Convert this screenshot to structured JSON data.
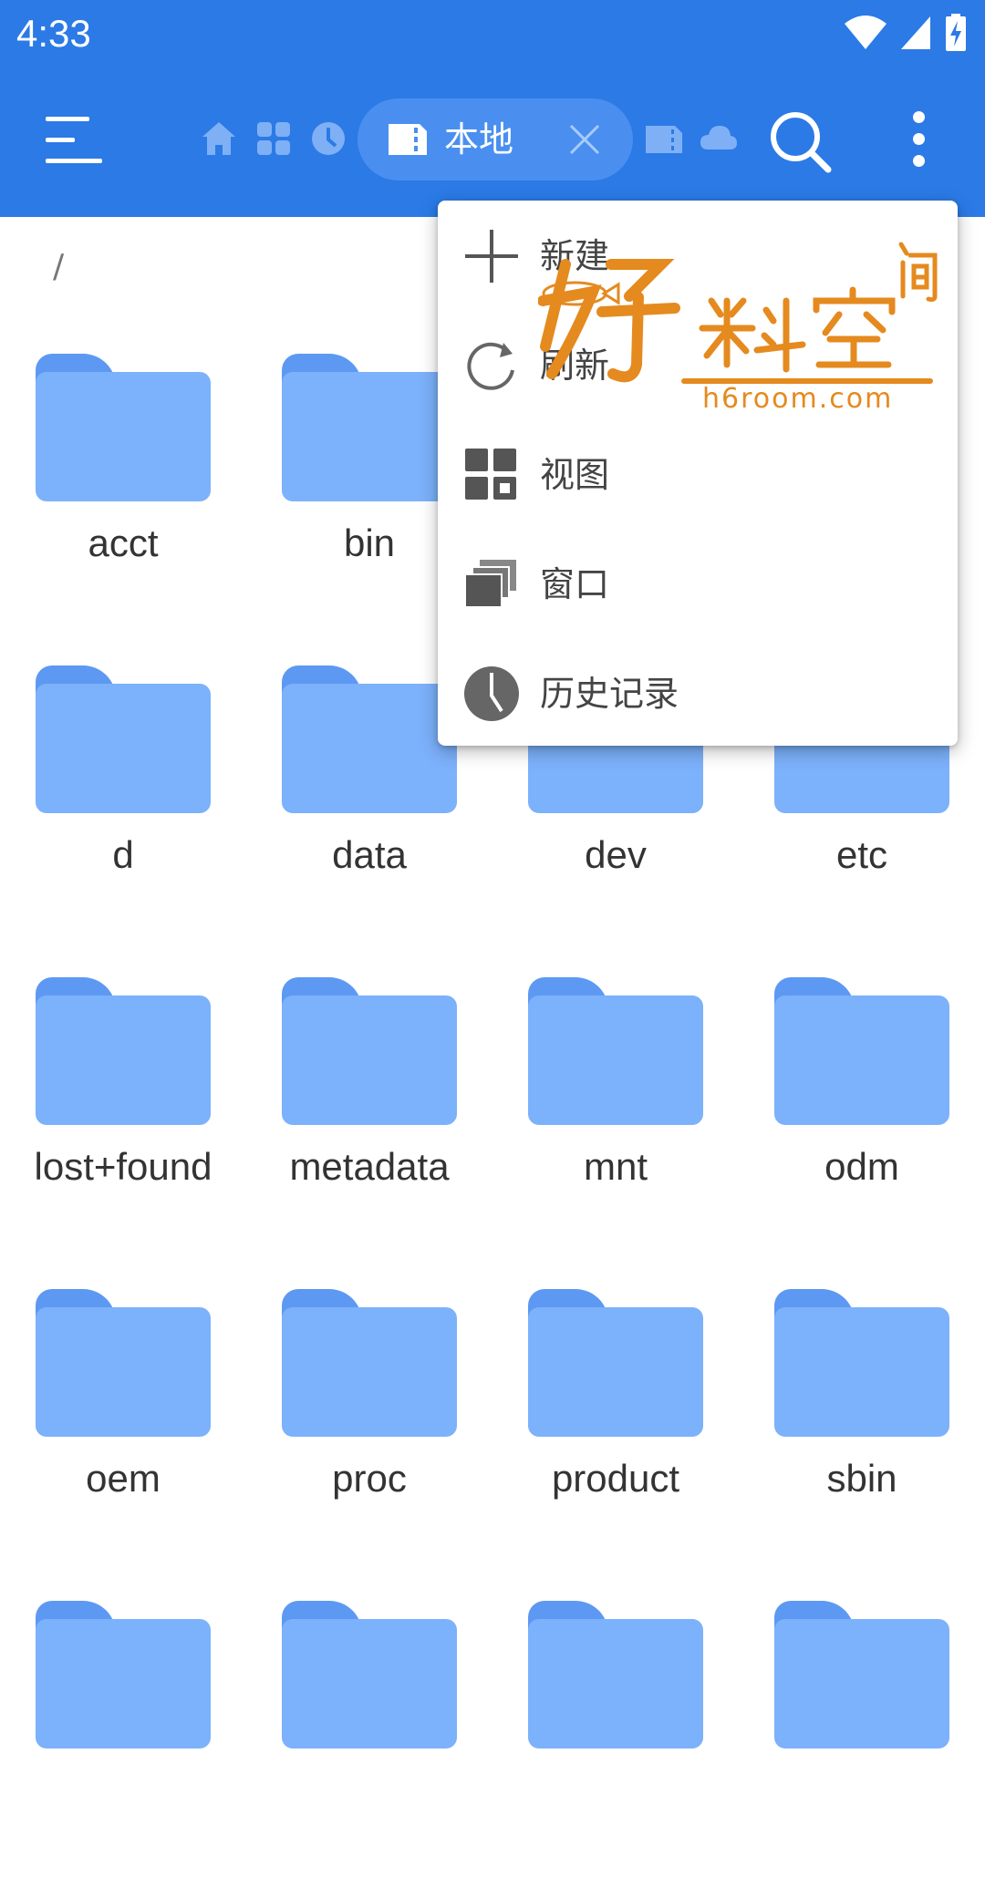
{
  "status_bar": {
    "time": "4:33"
  },
  "app_bar": {
    "active_tab_label": "本地",
    "tab_icons": [
      "home-icon",
      "apps-icon",
      "clock-icon",
      "sd-card-icon",
      "device-icon",
      "cloud-icon"
    ]
  },
  "path": "/",
  "folders": [
    {
      "name": "acct"
    },
    {
      "name": "bin"
    },
    {
      "name": ""
    },
    {
      "name": ""
    },
    {
      "name": "d"
    },
    {
      "name": "data"
    },
    {
      "name": "dev"
    },
    {
      "name": "etc"
    },
    {
      "name": "lost+found"
    },
    {
      "name": "metadata"
    },
    {
      "name": "mnt"
    },
    {
      "name": "odm"
    },
    {
      "name": "oem"
    },
    {
      "name": "proc"
    },
    {
      "name": "product"
    },
    {
      "name": "sbin"
    },
    {
      "name": ""
    },
    {
      "name": ""
    },
    {
      "name": ""
    },
    {
      "name": ""
    }
  ],
  "popup_menu": {
    "items": [
      {
        "label": "新建",
        "icon": "plus-icon"
      },
      {
        "label": "刷新",
        "icon": "refresh-icon"
      },
      {
        "label": "视图",
        "icon": "grid-view-icon"
      },
      {
        "label": "窗口",
        "icon": "windows-icon"
      },
      {
        "label": "历史记录",
        "icon": "history-icon"
      }
    ]
  },
  "watermark": {
    "chars": "好料空间",
    "url": "h6room.com"
  },
  "colors": {
    "primary": "#2b7ae6",
    "tab_active": "#4a8ff0",
    "folder_body": "#7cb1fb",
    "folder_tab": "#5d99f2",
    "watermark": "#e58a1f"
  }
}
